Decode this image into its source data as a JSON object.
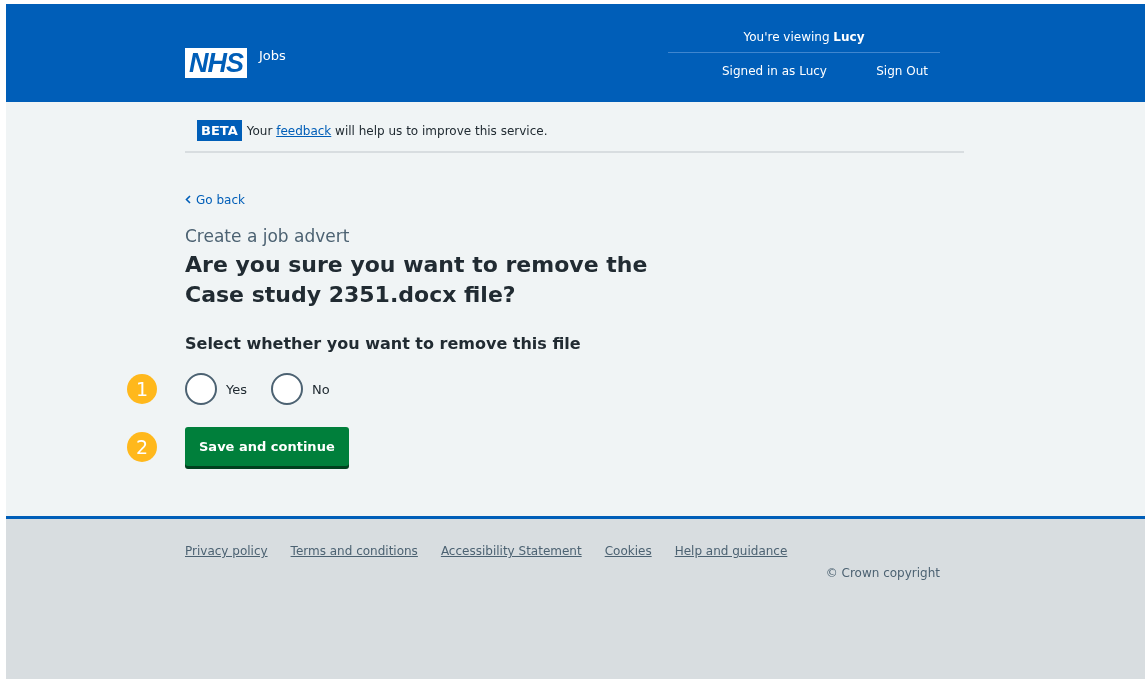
{
  "header": {
    "logo": "NHS",
    "service": "Jobs",
    "viewing_prefix": "You're viewing ",
    "viewing_name": "Lucy",
    "signed_in": "Signed in as Lucy",
    "sign_out": "Sign Out"
  },
  "beta": {
    "tag": "BETA",
    "before": "Your ",
    "link": "feedback",
    "after": " will help us to improve this service."
  },
  "back_link": "Go back",
  "caption": "Create a job advert",
  "heading": "Are you sure you want to remove the Case study 2351.docx file?",
  "legend": "Select whether you want to remove this file",
  "radios": [
    {
      "label": "Yes",
      "selected": false
    },
    {
      "label": "No",
      "selected": false
    }
  ],
  "radio_marker": "1",
  "button": {
    "label": "Save and continue",
    "marker": "2"
  },
  "footer": {
    "links": [
      "Privacy policy",
      "Terms and conditions",
      "Accessibility Statement",
      "Cookies",
      "Help and guidance"
    ],
    "copyright": "© Crown copyright"
  }
}
